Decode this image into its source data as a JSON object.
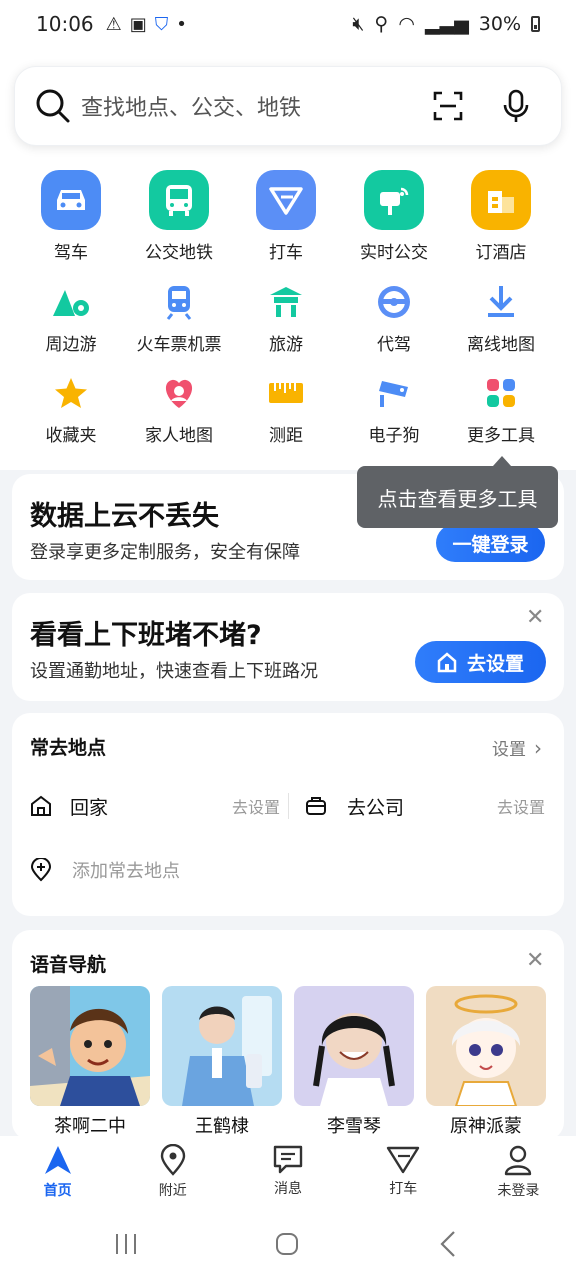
{
  "status": {
    "time": "10:06",
    "battery": "30%"
  },
  "search": {
    "placeholder": "查找地点、公交、地铁"
  },
  "grid": [
    {
      "label": "驾车",
      "icon": "car-icon"
    },
    {
      "label": "公交地铁",
      "icon": "bus-icon"
    },
    {
      "label": "打车",
      "icon": "taxi-icon"
    },
    {
      "label": "实时公交",
      "icon": "realtime-bus-icon"
    },
    {
      "label": "订酒店",
      "icon": "hotel-icon"
    },
    {
      "label": "周边游",
      "icon": "nearby-tour-icon"
    },
    {
      "label": "火车票机票",
      "icon": "train-icon"
    },
    {
      "label": "旅游",
      "icon": "travel-icon"
    },
    {
      "label": "代驾",
      "icon": "steering-wheel-icon"
    },
    {
      "label": "离线地图",
      "icon": "download-icon"
    },
    {
      "label": "收藏夹",
      "icon": "star-icon"
    },
    {
      "label": "家人地图",
      "icon": "family-map-icon"
    },
    {
      "label": "测距",
      "icon": "ruler-icon"
    },
    {
      "label": "电子狗",
      "icon": "camera-icon"
    },
    {
      "label": "更多工具",
      "icon": "more-tools-icon"
    }
  ],
  "tooltip": "点击查看更多工具",
  "cloud_card": {
    "title": "数据上云不丢失",
    "subtitle": "登录享更多定制服务，安全有保障",
    "button": "一键登录"
  },
  "commute_card": {
    "title": "看看上下班堵不堵?",
    "subtitle": "设置通勤地址，快速查看上下班路况",
    "button": "去设置"
  },
  "frequent": {
    "title": "常去地点",
    "settings": "设置",
    "home_label": "回家",
    "home_action": "去设置",
    "work_label": "去公司",
    "work_action": "去设置",
    "add_label": "添加常去地点"
  },
  "voice": {
    "title": "语音导航",
    "items": [
      {
        "name": "茶啊二中"
      },
      {
        "name": "王鹤棣"
      },
      {
        "name": "李雪琴"
      },
      {
        "name": "原神派蒙"
      }
    ]
  },
  "nav": [
    {
      "label": "首页"
    },
    {
      "label": "附近"
    },
    {
      "label": "消息"
    },
    {
      "label": "打车"
    },
    {
      "label": "未登录"
    }
  ],
  "colors": {
    "accent": "#1b66f0",
    "green": "#10c99b",
    "orange": "#f9b300"
  }
}
